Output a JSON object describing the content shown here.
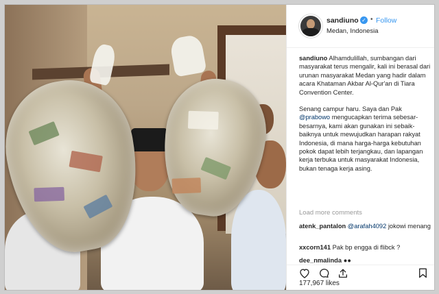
{
  "post": {
    "username": "sandiuno",
    "follow_label": "Follow",
    "separator": "•",
    "location": "Medan, Indonesia"
  },
  "caption": {
    "username": "sandiuno",
    "para1": "Alhamdulillah, sumbangan dari masyarakat terus mengalir, kali ini berasal dari urunan masyarakat Medan yang hadir dalam acara Khataman Akbar Al-Qur'an di Tiara Convention Center.",
    "para2_before": "Senang campur haru. Saya dan Pak ",
    "para2_mention": "@prabowo",
    "para2_after": " mengucapkan terima sebesar-besarnya, kami akan gunakan ini sebaik-baiknya untuk mewujudkan harapan rakyat Indonesia, di mana harga-harga kebutuhan pokok dapat lebih terjangkau, dan lapangan kerja terbuka untuk masyarakat Indonesia, bukan tenaga kerja asing."
  },
  "load_more": "Load more comments",
  "comments": [
    {
      "user": "atenk_pantalon",
      "mention": "@arafah4092",
      "text": " jokowi menang"
    },
    {
      "user": "xxcorn141",
      "mention": "",
      "text": " Pak bp engga di flibck ?"
    },
    {
      "user": "dee_nmalinda",
      "mention": "",
      "text": " ●●"
    }
  ],
  "likes": "177,967 likes",
  "colors": {
    "link": "#3897f0",
    "mention": "#003569",
    "text": "#262626"
  },
  "icons": [
    "heart-icon",
    "comment-icon",
    "share-icon",
    "bookmark-icon",
    "verified-badge-icon"
  ]
}
